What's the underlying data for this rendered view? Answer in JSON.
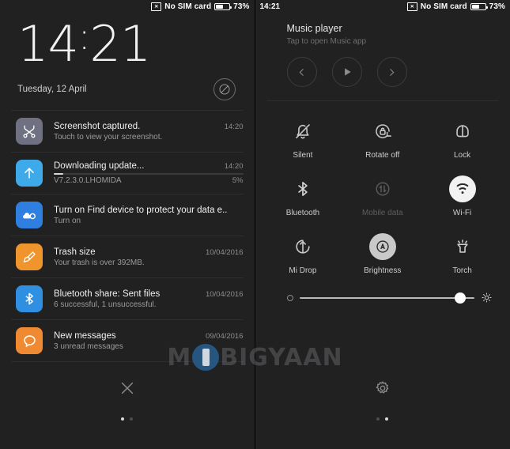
{
  "status_bar": {
    "left_time": "14:21",
    "sim_icon": "sim-card-off-icon",
    "sim_text": "No SIM card",
    "battery_icon": "battery-icon",
    "battery_text": "73%",
    "battery_level": 58
  },
  "left_panel": {
    "name": "notification-shade",
    "clock": {
      "hours": "14",
      "colon": ":",
      "minutes": "21"
    },
    "date": "Tuesday, 12 April",
    "dnd_icon": "do-not-disturb-icon",
    "notifications": [
      {
        "icon": "screenshot-scissors-icon",
        "icon_bg": "#6f7183",
        "title": "Screenshot captured.",
        "subtitle": "Touch to view your screenshot.",
        "time": "14:20"
      },
      {
        "icon": "download-arrow-up-icon",
        "icon_bg": "#3eaaea",
        "title": "Downloading update...",
        "subtitle": "V7.2.3.0.LHOMIDA",
        "time": "14:20",
        "progress_label": "5%",
        "progress_value": 5
      },
      {
        "icon": "mi-cloud-icon",
        "icon_bg": "#2f7fe0",
        "title": "Turn on Find device to protect your data e..",
        "subtitle": "Turn on",
        "time": ""
      },
      {
        "icon": "cleaner-broom-icon",
        "icon_bg": "#f0952e",
        "title": "Trash size",
        "subtitle": "Your trash is over 392MB.",
        "time": "10/04/2016"
      },
      {
        "icon": "bluetooth-icon",
        "icon_bg": "#2f8fe0",
        "title": "Bluetooth share: Sent files",
        "subtitle": "6 successful, 1 unsuccessful.",
        "time": "10/04/2016"
      },
      {
        "icon": "message-bubble-icon",
        "icon_bg": "#ef8a33",
        "title": "New messages",
        "subtitle": "3 unread messages",
        "time": "09/04/2016"
      }
    ],
    "clear_button_icon": "close-x-icon",
    "page_dots": {
      "count": 2,
      "active_index": 0
    }
  },
  "right_panel": {
    "name": "quick-settings-shade",
    "music": {
      "title": "Music player",
      "subtitle": "Tap to open Music app",
      "controls": [
        {
          "icon": "previous-track-icon",
          "label": "Previous"
        },
        {
          "icon": "play-icon",
          "label": "Play"
        },
        {
          "icon": "next-track-icon",
          "label": "Next"
        }
      ]
    },
    "toggles": [
      [
        {
          "icon": "bell-off-icon",
          "label": "Silent",
          "state": "off"
        },
        {
          "icon": "rotate-lock-icon",
          "label": "Rotate off",
          "state": "off"
        },
        {
          "icon": "lock-icon",
          "label": "Lock",
          "state": "off"
        }
      ],
      [
        {
          "icon": "bluetooth-icon",
          "label": "Bluetooth",
          "state": "off"
        },
        {
          "icon": "mobile-data-icon",
          "label": "Mobile data",
          "state": "disabled"
        },
        {
          "icon": "wifi-icon",
          "label": "Wi-Fi",
          "state": "on"
        }
      ],
      [
        {
          "icon": "mi-drop-icon",
          "label": "Mi Drop",
          "state": "off"
        },
        {
          "icon": "brightness-auto-icon",
          "label": "Brightness",
          "state": "on"
        },
        {
          "icon": "torch-icon",
          "label": "Torch",
          "state": "off"
        }
      ]
    ],
    "brightness": {
      "min_icon": "brightness-low-icon",
      "max_icon": "brightness-high-sun-icon",
      "value": 92
    },
    "settings_button_icon": "gear-icon",
    "page_dots": {
      "count": 2,
      "active_index": 1
    }
  },
  "watermark": {
    "before": "M",
    "after": "BIGYAAN",
    "logo_icon": "phone-logo-icon"
  }
}
